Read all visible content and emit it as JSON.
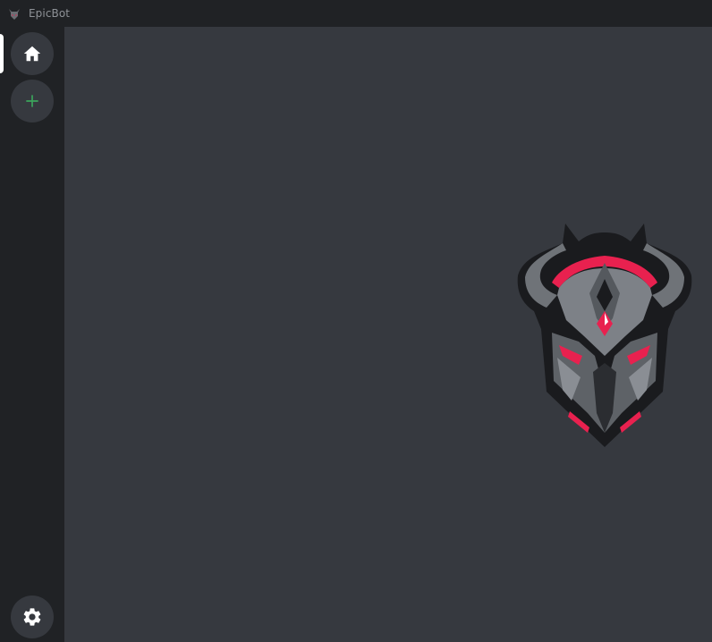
{
  "window": {
    "title": "EpicBot",
    "app_icon": "demon-helmet-icon"
  },
  "sidebar": {
    "items": [
      {
        "name": "home",
        "icon": "home-icon",
        "active": true
      },
      {
        "name": "add-server",
        "icon": "plus-icon",
        "accent": "#3ba55c"
      },
      {
        "name": "settings",
        "icon": "gear-icon"
      }
    ]
  },
  "main": {
    "logo": "demon-helmet-logo"
  },
  "colors": {
    "titlebar": "#202225",
    "sidebar": "#202225",
    "main_bg": "#36393f",
    "accent_red": "#e8214f",
    "add_green": "#3ba55c"
  }
}
